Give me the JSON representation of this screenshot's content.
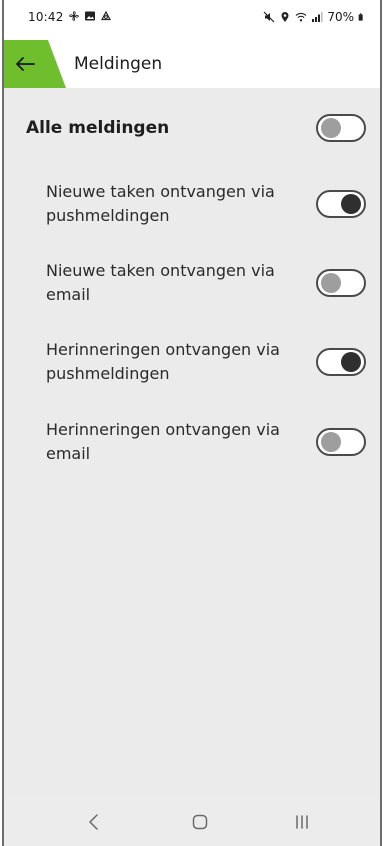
{
  "status_bar": {
    "time": "10:42",
    "battery": "70%",
    "left_icons": [
      "fan-icon",
      "image-icon",
      "sync-icon"
    ],
    "right_icons": [
      "mute-icon",
      "location-icon",
      "wifi-icon",
      "signal-icon",
      "battery-icon"
    ]
  },
  "header": {
    "title": "Meldingen",
    "accent_color": "#6fbe2e"
  },
  "settings": {
    "all": {
      "label": "Alle meldingen",
      "enabled": false
    },
    "items": [
      {
        "label": "Nieuwe taken ontvangen via pushmeldingen",
        "enabled": true
      },
      {
        "label": "Nieuwe taken ontvangen via email",
        "enabled": false
      },
      {
        "label": "Herinneringen ontvangen via pushmeldingen",
        "enabled": true
      },
      {
        "label": "Herinneringen ontvangen via email",
        "enabled": false
      }
    ]
  },
  "nav_bar": {
    "buttons": [
      "back-nav-icon",
      "home-nav-icon",
      "recents-nav-icon"
    ]
  }
}
